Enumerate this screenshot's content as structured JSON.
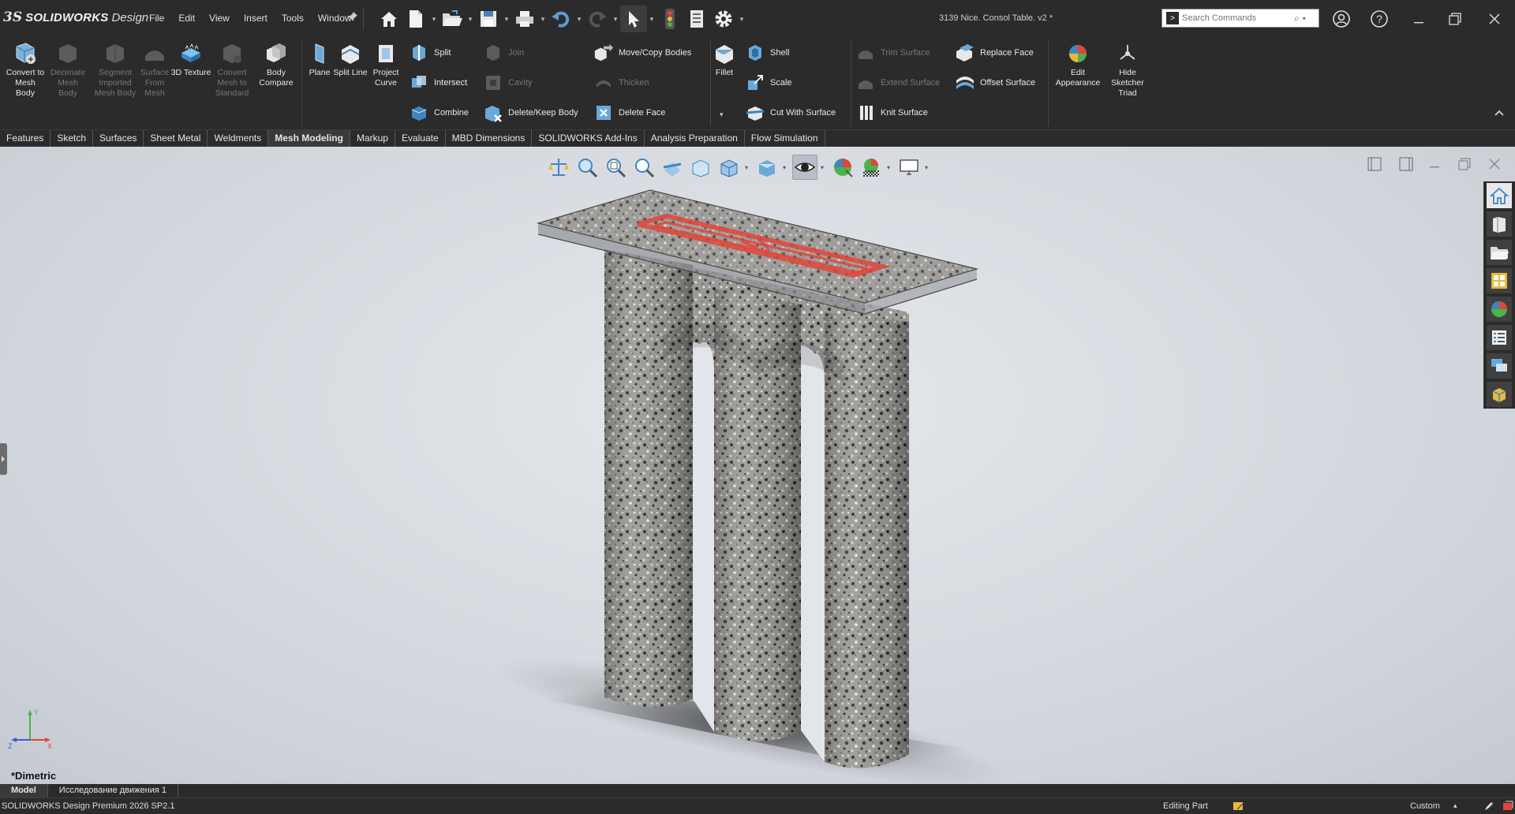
{
  "app": {
    "logo_prefix": "3S",
    "brand": "SOLIDWORKS",
    "edition": "Design"
  },
  "menu": [
    "File",
    "Edit",
    "View",
    "Insert",
    "Tools",
    "Window"
  ],
  "document_title": "3139 Nice. Consol Table. v2 *",
  "search": {
    "placeholder": "Search Commands"
  },
  "ribbon": {
    "mesh_group": [
      {
        "label": "Convert to Mesh Body",
        "icon": "convert-mesh-icon",
        "enabled": true
      },
      {
        "label": "Decimate Mesh Body",
        "icon": "decimate-mesh-icon",
        "enabled": false
      },
      {
        "label": "Segment Imported Mesh Body",
        "icon": "segment-mesh-icon",
        "enabled": false
      },
      {
        "label": "Surface From Mesh",
        "icon": "surface-from-mesh-icon",
        "enabled": false
      },
      {
        "label": "3D Texture",
        "icon": "texture-3d-icon",
        "enabled": true
      },
      {
        "label": "Convert Mesh to Standard",
        "icon": "convert-standard-icon",
        "enabled": false
      },
      {
        "label": "Body Compare",
        "icon": "body-compare-icon",
        "enabled": true
      }
    ],
    "ref_group": [
      {
        "label": "Plane",
        "icon": "plane-icon"
      },
      {
        "label": "Split Line",
        "icon": "split-line-icon"
      },
      {
        "label": "Project Curve",
        "icon": "project-curve-icon"
      }
    ],
    "col1": [
      {
        "label": "Split",
        "enabled": true
      },
      {
        "label": "Intersect",
        "enabled": true
      },
      {
        "label": "Combine",
        "enabled": true
      }
    ],
    "col2": [
      {
        "label": "Join",
        "enabled": false
      },
      {
        "label": "Cavity",
        "enabled": false
      },
      {
        "label": "Delete/Keep Body",
        "enabled": true
      }
    ],
    "col3": [
      {
        "label": "Move/Copy Bodies",
        "enabled": true
      },
      {
        "label": "Thicken",
        "enabled": false
      },
      {
        "label": "Delete Face",
        "enabled": true
      }
    ],
    "fillet": {
      "label": "Fillet"
    },
    "col4": [
      {
        "label": "Shell",
        "enabled": true
      },
      {
        "label": "Scale",
        "enabled": true
      },
      {
        "label": "Cut With Surface",
        "enabled": true
      }
    ],
    "col5": [
      {
        "label": "Trim Surface",
        "enabled": false
      },
      {
        "label": "Extend Surface",
        "enabled": false
      },
      {
        "label": "Knit Surface",
        "enabled": true
      }
    ],
    "col6": [
      {
        "label": "Replace Face",
        "enabled": true
      },
      {
        "label": "Offset Surface",
        "enabled": true
      }
    ],
    "appearance": {
      "label": "Edit Appearance"
    },
    "triad": {
      "label": "Hide Sketcher Triad"
    }
  },
  "tabs": [
    {
      "label": "Features",
      "active": false
    },
    {
      "label": "Sketch",
      "active": false
    },
    {
      "label": "Surfaces",
      "active": false
    },
    {
      "label": "Sheet Metal",
      "active": false
    },
    {
      "label": "Weldments",
      "active": false
    },
    {
      "label": "Mesh Modeling",
      "active": true
    },
    {
      "label": "Markup",
      "active": false
    },
    {
      "label": "Evaluate",
      "active": false
    },
    {
      "label": "MBD Dimensions",
      "active": false
    },
    {
      "label": "SOLIDWORKS Add-Ins",
      "active": false
    },
    {
      "label": "Analysis Preparation",
      "active": false
    },
    {
      "label": "Flow Simulation",
      "active": false
    }
  ],
  "viewport": {
    "view_orientation": "*Dimetric",
    "triad": {
      "x": "X",
      "y": "Y",
      "z": "Z"
    }
  },
  "bottom_tabs": [
    {
      "label": "Model",
      "active": true
    },
    {
      "label": "Исследование движения 1",
      "active": false
    }
  ],
  "status": {
    "product": "SOLIDWORKS Design Premium 2026 SP2.1",
    "mode": "Editing Part",
    "units": "Custom"
  },
  "colors": {
    "chrome": "#2b2b2b",
    "tab_active": "#3a3a3a",
    "viewport_bg": "#d4d8de",
    "accent_red": "#e0453a"
  }
}
